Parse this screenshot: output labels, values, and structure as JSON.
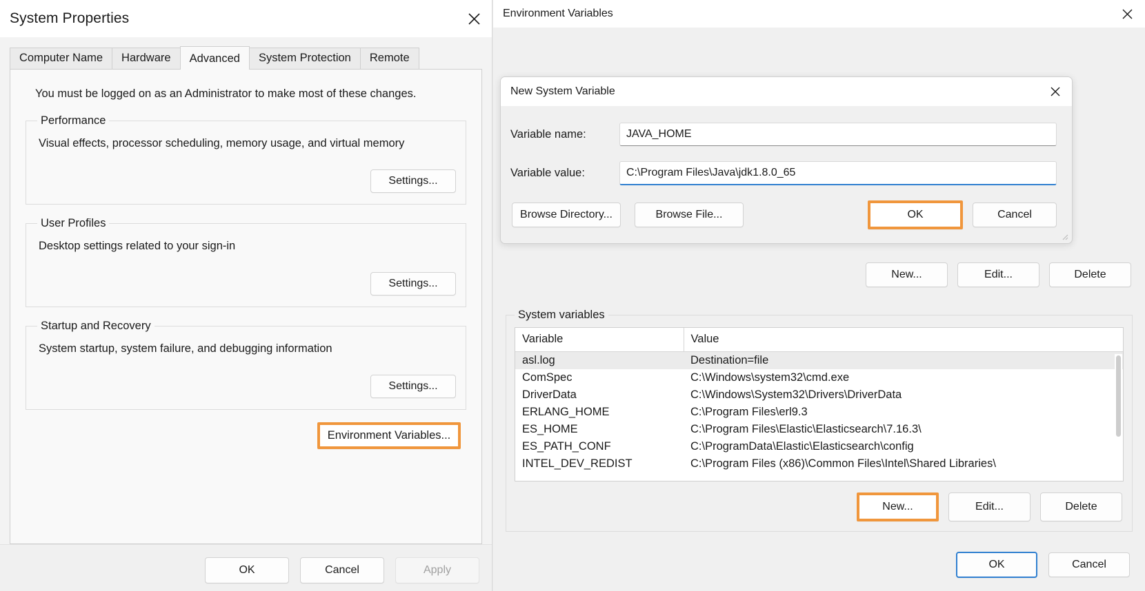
{
  "system_properties": {
    "title": "System Properties",
    "close_icon": "close-icon",
    "tabs": [
      {
        "label": "Computer Name",
        "active": false
      },
      {
        "label": "Hardware",
        "active": false
      },
      {
        "label": "Advanced",
        "active": true
      },
      {
        "label": "System Protection",
        "active": false
      },
      {
        "label": "Remote",
        "active": false
      }
    ],
    "admin_note": "You must be logged on as an Administrator to make most of these changes.",
    "groups": [
      {
        "legend": "Performance",
        "description": "Visual effects, processor scheduling, memory usage, and virtual memory",
        "button": "Settings..."
      },
      {
        "legend": "User Profiles",
        "description": "Desktop settings related to your sign-in",
        "button": "Settings..."
      },
      {
        "legend": "Startup and Recovery",
        "description": "System startup, system failure, and debugging information",
        "button": "Settings..."
      }
    ],
    "environment_variables_button": "Environment Variables...",
    "footer": {
      "ok": "OK",
      "cancel": "Cancel",
      "apply": "Apply"
    }
  },
  "environment_variables": {
    "title": "Environment Variables",
    "close_icon": "close-icon",
    "user_variables_buttons": {
      "new": "New...",
      "edit": "Edit...",
      "delete": "Delete"
    },
    "system_variables": {
      "legend": "System variables",
      "columns": [
        "Variable",
        "Value"
      ],
      "rows": [
        {
          "variable": "asl.log",
          "value": "Destination=file",
          "selected": true
        },
        {
          "variable": "ComSpec",
          "value": "C:\\Windows\\system32\\cmd.exe",
          "selected": false
        },
        {
          "variable": "DriverData",
          "value": "C:\\Windows\\System32\\Drivers\\DriverData",
          "selected": false
        },
        {
          "variable": "ERLANG_HOME",
          "value": "C:\\Program Files\\erl9.3",
          "selected": false
        },
        {
          "variable": "ES_HOME",
          "value": "C:\\Program Files\\Elastic\\Elasticsearch\\7.16.3\\",
          "selected": false
        },
        {
          "variable": "ES_PATH_CONF",
          "value": "C:\\ProgramData\\Elastic\\Elasticsearch\\config",
          "selected": false
        },
        {
          "variable": "INTEL_DEV_REDIST",
          "value": "C:\\Program Files (x86)\\Common Files\\Intel\\Shared Libraries\\",
          "selected": false
        }
      ],
      "buttons": {
        "new": "New...",
        "edit": "Edit...",
        "delete": "Delete"
      }
    },
    "footer": {
      "ok": "OK",
      "cancel": "Cancel"
    }
  },
  "new_system_variable": {
    "title": "New System Variable",
    "close_icon": "close-icon",
    "variable_name_label": "Variable name:",
    "variable_name_value": "JAVA_HOME",
    "variable_name_placeholder": "",
    "variable_value_label": "Variable value:",
    "variable_value_value": "C:\\Program Files\\Java\\jdk1.8.0_65",
    "variable_value_placeholder": "",
    "browse_directory": "Browse Directory...",
    "browse_file": "Browse File...",
    "ok": "OK",
    "cancel": "Cancel"
  },
  "colors": {
    "highlight": "#f0963c",
    "accent": "#2f7fd0",
    "window_bg": "#f0f0f0",
    "panel_bg": "#f9f9f9"
  }
}
